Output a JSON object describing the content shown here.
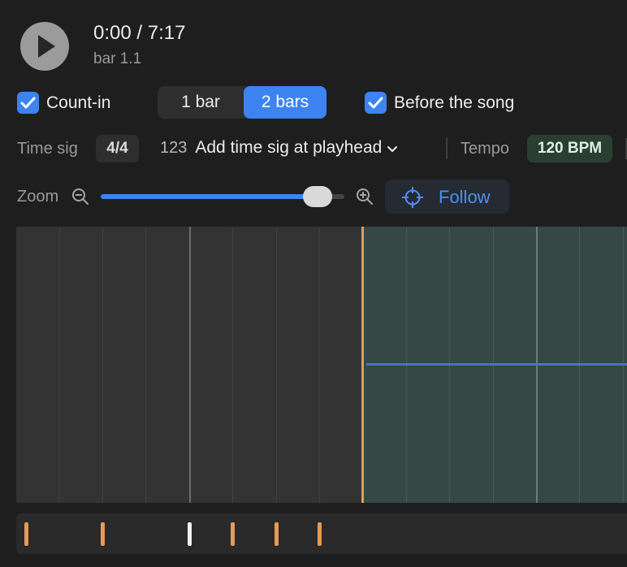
{
  "transport": {
    "time": "0:00 / 7:17",
    "bar_position": "bar 1.1",
    "play_icon": "play-icon"
  },
  "count_in": {
    "enabled": true,
    "label": "Count-in",
    "options": [
      "1 bar",
      "2 bars"
    ],
    "selected": "2 bars",
    "before_song_enabled": true,
    "before_song_label": "Before the song"
  },
  "time_signature": {
    "label": "Time sig",
    "value": "4/4",
    "add_icon_text": "123",
    "add_label": "Add time sig at playhead"
  },
  "tempo": {
    "label": "Tempo",
    "value": "120 BPM"
  },
  "zoom": {
    "label": "Zoom",
    "level": 0.89,
    "follow_label": "Follow"
  },
  "colors": {
    "accent": "#3d84f0",
    "playhead": "#e59a56",
    "song_region": "#354846",
    "tempo_pill": "#2a3f30"
  }
}
